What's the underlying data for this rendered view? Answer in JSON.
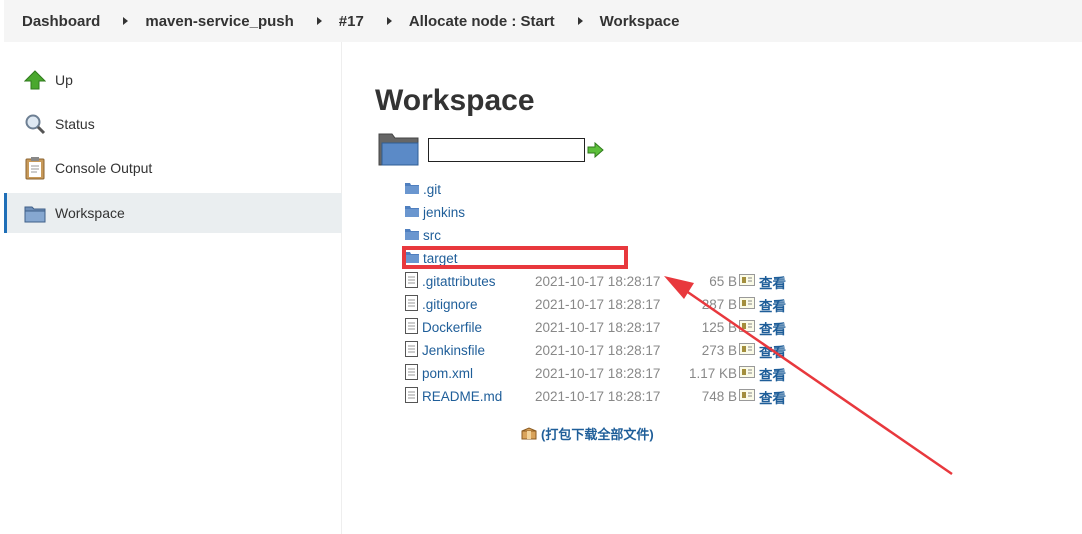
{
  "breadcrumb": [
    "Dashboard",
    "maven-service_push",
    "#17",
    "Allocate node : Start",
    "Workspace"
  ],
  "sidebar": {
    "items": [
      {
        "label": "Up",
        "icon": "up-arrow-icon"
      },
      {
        "label": "Status",
        "icon": "magnifier-icon"
      },
      {
        "label": "Console Output",
        "icon": "clipboard-icon"
      },
      {
        "label": "Workspace",
        "icon": "folder-icon",
        "active": true
      }
    ]
  },
  "main": {
    "title": "Workspace",
    "path_value": "",
    "folders": [
      ".git",
      "jenkins",
      "src",
      "target"
    ],
    "files": [
      {
        "name": ".gitattributes",
        "date": "2021-10-17 18:28:17",
        "size": "65 B",
        "view": "查看"
      },
      {
        "name": ".gitignore",
        "date": "2021-10-17 18:28:17",
        "size": "287 B",
        "view": "查看"
      },
      {
        "name": "Dockerfile",
        "date": "2021-10-17 18:28:17",
        "size": "125 B",
        "view": "查看"
      },
      {
        "name": "Jenkinsfile",
        "date": "2021-10-17 18:28:17",
        "size": "273 B",
        "view": "查看"
      },
      {
        "name": "pom.xml",
        "date": "2021-10-17 18:28:17",
        "size": "1.17 KB",
        "view": "查看"
      },
      {
        "name": "README.md",
        "date": "2021-10-17 18:28:17",
        "size": "748 B",
        "view": "查看"
      }
    ],
    "download_all": "(打包下载全部文件)"
  },
  "annotation": {
    "color": "#e8383d"
  }
}
